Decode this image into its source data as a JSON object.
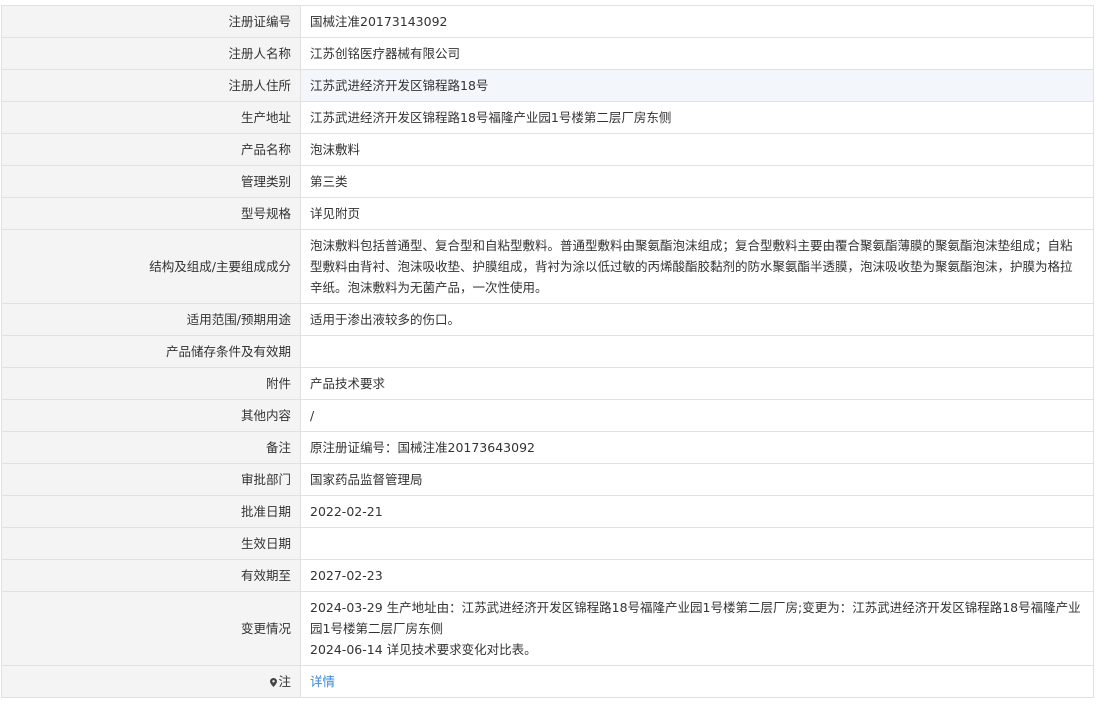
{
  "rows": [
    {
      "label": "注册证编号",
      "value": "国械注准20173143092"
    },
    {
      "label": "注册人名称",
      "value": "江苏创铭医疗器械有限公司"
    },
    {
      "label": "注册人住所",
      "value": "江苏武进经济开发区锦程路18号"
    },
    {
      "label": "生产地址",
      "value": "江苏武进经济开发区锦程路18号福隆产业园1号楼第二层厂房东侧"
    },
    {
      "label": "产品名称",
      "value": "泡沫敷料"
    },
    {
      "label": "管理类别",
      "value": "第三类"
    },
    {
      "label": "型号规格",
      "value": "详见附页"
    },
    {
      "label": "结构及组成/主要组成成分",
      "value": "泡沫敷料包括普通型、复合型和自粘型敷料。普通型敷料由聚氨酯泡沫组成；复合型敷料主要由覆合聚氨酯薄膜的聚氨酯泡沫垫组成；自粘型敷料由背衬、泡沫吸收垫、护膜组成，背衬为涂以低过敏的丙烯酸酯胶黏剂的防水聚氨酯半透膜，泡沫吸收垫为聚氨酯泡沫，护膜为格拉辛纸。泡沫敷料为无菌产品，一次性使用。"
    },
    {
      "label": "适用范围/预期用途",
      "value": "适用于渗出液较多的伤口。"
    },
    {
      "label": "产品储存条件及有效期",
      "value": ""
    },
    {
      "label": "附件",
      "value": "产品技术要求"
    },
    {
      "label": "其他内容",
      "value": "/"
    },
    {
      "label": "备注",
      "value": "原注册证编号：国械注准20173643092"
    },
    {
      "label": "审批部门",
      "value": "国家药品监督管理局"
    },
    {
      "label": "批准日期",
      "value": "2022-02-21"
    },
    {
      "label": "生效日期",
      "value": ""
    },
    {
      "label": "有效期至",
      "value": "2027-02-23"
    }
  ],
  "changes": {
    "label": "变更情况",
    "line1": "2024-03-29 生产地址由：江苏武进经济开发区锦程路18号福隆产业园1号楼第二层厂房;变更为：江苏武进经济开发区锦程路18号福隆产业园1号楼第二层厂房东侧",
    "line2": "2024-06-14 详见技术要求变化对比表。"
  },
  "note": {
    "icon": "map-pin-icon",
    "label": "注",
    "link_text": "详情"
  },
  "colors": {
    "label_bg": "#f4f4f4",
    "highlight_bg": "#f3f6fb",
    "border": "#e1e1e1",
    "link": "#3a86d8"
  }
}
